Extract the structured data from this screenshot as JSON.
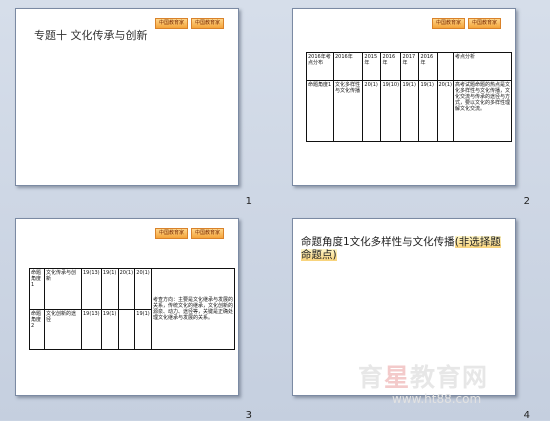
{
  "badges": [
    "中国教育家",
    "中国教育家"
  ],
  "slide1": {
    "title": "专题十   文化传承与创新",
    "number": "1"
  },
  "slide2": {
    "number": "2",
    "header": [
      "2016年考点分布",
      "2016年",
      "2015年",
      "2016年",
      "2017年",
      "2016年",
      "",
      "考点分析"
    ],
    "row1_left": "命题角度1",
    "row1_topic": "文化多样性与文化传播",
    "row1_vals": [
      "20(1)",
      "19(10)",
      "19(1)",
      "19(1)",
      "20(1)"
    ],
    "analysis": "高考试题命题的热点是文化多样性与文化传播，文化交流与传承的途径与方式，要以文化的多样性理解文化交流。"
  },
  "slide3": {
    "number": "3",
    "row1_left": "命题角度1",
    "row1_topic": "文化传承与创新",
    "row2_left": "命题角度2",
    "row2_topic": "文化创新的途径",
    "vals": [
      "19(13)",
      "19(1)",
      "20(1)",
      "20(1)",
      "19(13)",
      "19(1)",
      "19(1)"
    ],
    "analysis": "考查方向：主要是文化继承与发展的关系，传统文化的继承，文化创新的源泉、动力、途径等，关键是正确处理文化继承与发展的关系。"
  },
  "slide4": {
    "number": "4",
    "heading_prefix": "命题角度1文化多样性与文化传播",
    "heading_highlight": "(非选择题命题点)"
  },
  "watermark": {
    "text_a": "育",
    "text_b": "星",
    "text_c": "教育网",
    "url": "www.ht88.com"
  }
}
